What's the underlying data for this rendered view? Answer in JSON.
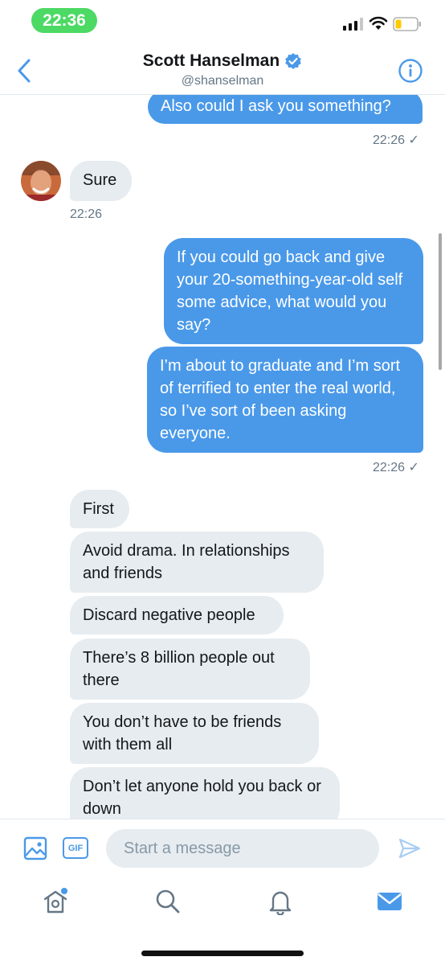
{
  "status_bar": {
    "time": "22:36"
  },
  "header": {
    "title": "Scott Hanselman",
    "handle": "@shanselman"
  },
  "messages": [
    {
      "side": "sent",
      "text": "Also could I ask you something?"
    },
    {
      "side": "sent",
      "timestamp": "22:26 ✓"
    },
    {
      "side": "received",
      "text": "Sure"
    },
    {
      "side": "received",
      "timestamp": "22:26"
    },
    {
      "side": "sent",
      "text": "If you could go back and give your 20-something-year-old self some advice, what would you say?"
    },
    {
      "side": "sent",
      "text": "I’m about to graduate and I’m sort of terrified to enter the real world, so I’ve sort of been asking everyone."
    },
    {
      "side": "sent",
      "timestamp": "22:26 ✓"
    },
    {
      "side": "received",
      "text": "First"
    },
    {
      "side": "received",
      "text": "Avoid drama. In relationships and friends"
    },
    {
      "side": "received",
      "text": "Discard negative people"
    },
    {
      "side": "received",
      "text": "There’s 8 billion people out there"
    },
    {
      "side": "received",
      "text": "You don’t have to be friends with them all"
    },
    {
      "side": "received",
      "text": "Don’t let anyone hold you back or down"
    }
  ],
  "composer": {
    "placeholder": "Start a message",
    "gif_label": "GIF"
  },
  "colors": {
    "accent": "#4a99e9",
    "received_bubble": "#e6ecf0",
    "status_time_pill": "#4cd964"
  },
  "icons": {
    "back": "chevron-left-icon",
    "verified": "verified-badge-icon",
    "info": "info-icon",
    "image": "image-icon",
    "send": "send-icon",
    "tabs": [
      "home-icon",
      "search-icon",
      "bell-icon",
      "mail-icon"
    ]
  }
}
